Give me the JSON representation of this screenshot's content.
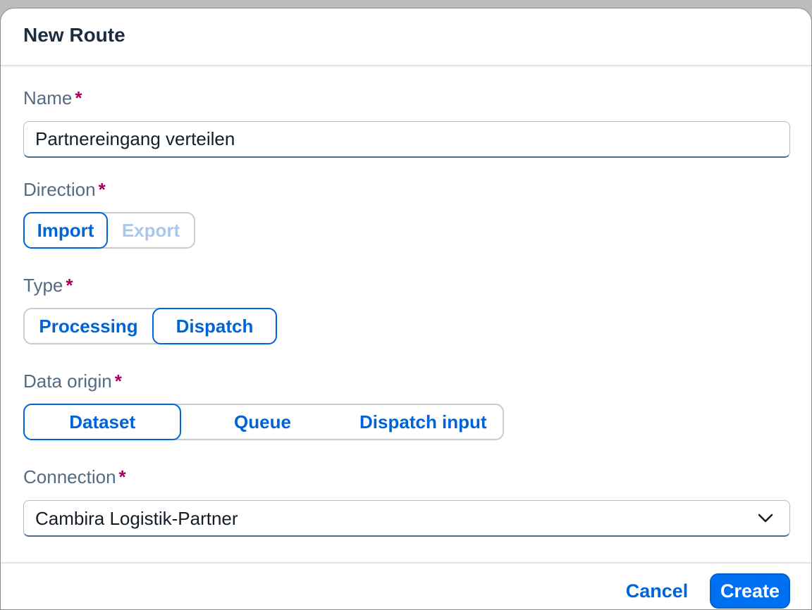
{
  "dialog": {
    "title": "New Route"
  },
  "fields": {
    "name": {
      "label": "Name",
      "required_mark": "*",
      "value": "Partnereingang verteilen"
    },
    "direction": {
      "label": "Direction",
      "required_mark": "*",
      "options": [
        {
          "label": "Import",
          "selected": true,
          "enabled": true
        },
        {
          "label": "Export",
          "selected": false,
          "enabled": false
        }
      ]
    },
    "type": {
      "label": "Type",
      "required_mark": "*",
      "options": [
        {
          "label": "Processing",
          "selected": false,
          "enabled": true
        },
        {
          "label": "Dispatch",
          "selected": true,
          "enabled": true
        }
      ]
    },
    "data_origin": {
      "label": "Data origin",
      "required_mark": "*",
      "options": [
        {
          "label": "Dataset",
          "selected": true,
          "enabled": true
        },
        {
          "label": "Queue",
          "selected": false,
          "enabled": true
        },
        {
          "label": "Dispatch input",
          "selected": false,
          "enabled": true
        }
      ]
    },
    "connection": {
      "label": "Connection",
      "required_mark": "*",
      "selected_value": "Cambira Logistik-Partner",
      "icon": "chevron-down-icon"
    }
  },
  "footer": {
    "cancel_label": "Cancel",
    "create_label": "Create"
  },
  "colors": {
    "accent": "#0064d9",
    "primary_button": "#0070f2",
    "required": "#a1005d",
    "label": "#556b82",
    "title": "#1d2d3e"
  }
}
